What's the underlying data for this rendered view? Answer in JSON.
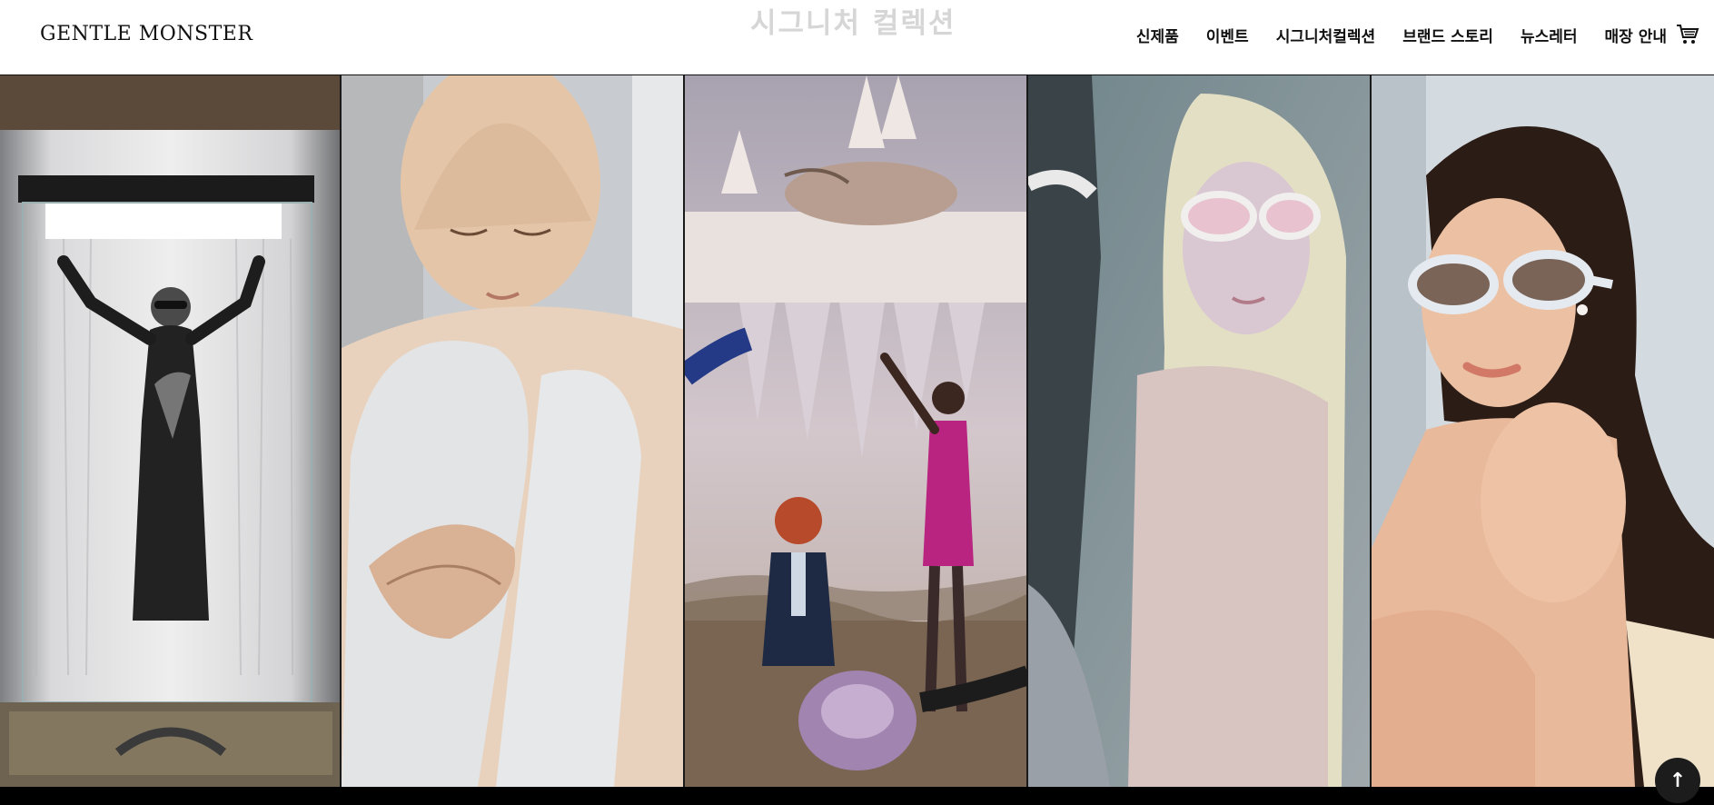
{
  "header": {
    "logo": "GENTLE MONSTER",
    "ghost_title": "시그니처 컬렉션",
    "nav": [
      "신제품",
      "이벤트",
      "시그니처컬렉션",
      "브랜드 스토리",
      "뉴스레터",
      "매장 안내"
    ],
    "cart_icon": "cart-icon"
  },
  "gallery": {
    "panels": [
      {
        "subject": "mannequin in glass display case",
        "palette": [
          "#5b4a3a",
          "#d8d6d4",
          "#1a1a1a"
        ]
      },
      {
        "subject": "hyperreal sculpture of seated man",
        "palette": [
          "#cfd3d6",
          "#e6c6a9",
          "#8a8d90"
        ]
      },
      {
        "subject": "surreal floating island with figures",
        "palette": [
          "#c9c0c8",
          "#b8247f",
          "#1e2a44"
        ]
      },
      {
        "subject": "platinum-haired model with white sunglasses",
        "palette": [
          "#7a8e93",
          "#e3d6d0",
          "#cfd8b8"
        ]
      },
      {
        "subject": "model with white oval sunglasses",
        "palette": [
          "#cfd6dc",
          "#e8b89c",
          "#2b1c15"
        ]
      }
    ]
  },
  "scroll_top": {
    "icon": "arrow-up-icon",
    "glyph": "↑"
  }
}
